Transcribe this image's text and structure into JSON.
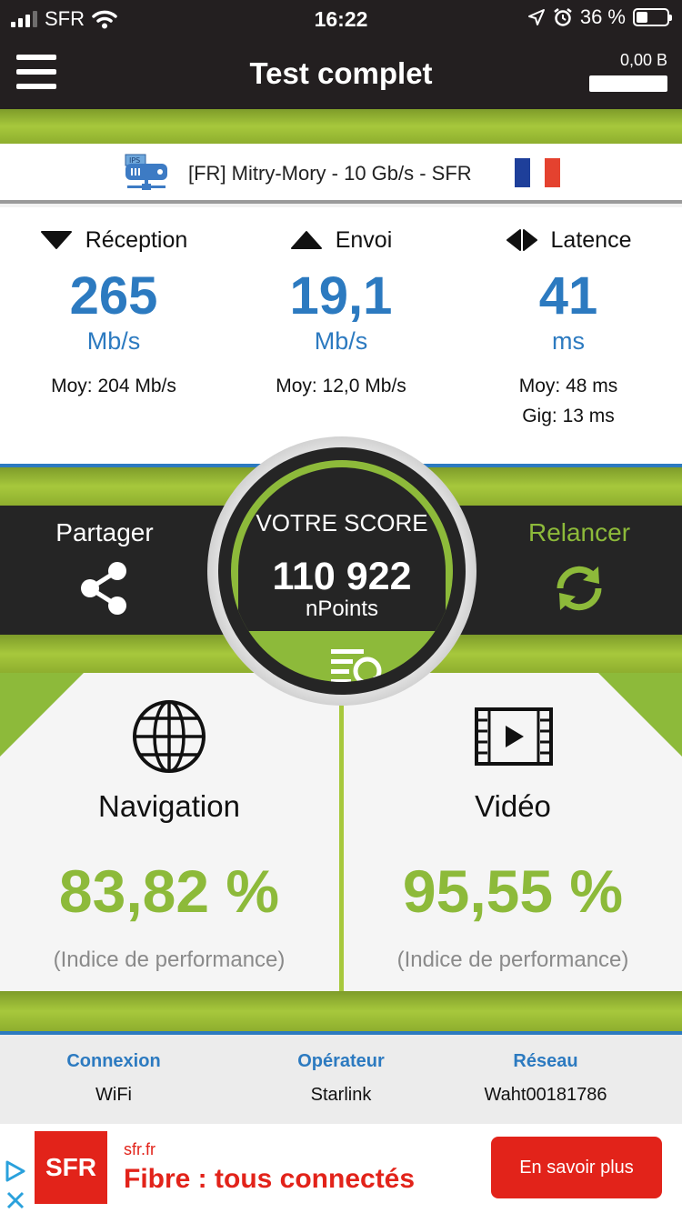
{
  "status_bar": {
    "carrier": "SFR",
    "time": "16:22",
    "battery_percent": "36 %",
    "battery_level": 0.36
  },
  "header": {
    "title": "Test complet",
    "data_used": "0,00 B"
  },
  "server": {
    "icon_label": "IPS",
    "name": "[FR] Mitry-Mory - 10 Gb/s - SFR",
    "flag_colors": [
      "#1e3f9a",
      "#ffffff",
      "#e4422f"
    ]
  },
  "metrics": {
    "download": {
      "label": "Réception",
      "value": "265",
      "unit": "Mb/s",
      "average": "Moy: 204 Mb/s"
    },
    "upload": {
      "label": "Envoi",
      "value": "19,1",
      "unit": "Mb/s",
      "average": "Moy: 12,0 Mb/s"
    },
    "latency": {
      "label": "Latence",
      "value": "41",
      "unit": "ms",
      "average": "Moy: 48 ms",
      "jitter": "Gig: 13 ms"
    }
  },
  "score": {
    "title": "VOTRE SCORE",
    "value": "110 922",
    "unit": "nPoints",
    "share_label": "Partager",
    "retry_label": "Relancer"
  },
  "panels": {
    "navigation": {
      "title": "Navigation",
      "value": "83,82 %",
      "note": "(Indice de performance)"
    },
    "video": {
      "title": "Vidéo",
      "value": "95,55 %",
      "note": "(Indice de performance)"
    }
  },
  "info": {
    "connection": {
      "label": "Connexion",
      "value": "WiFi"
    },
    "operator": {
      "label": "Opérateur",
      "value": "Starlink"
    },
    "network": {
      "label": "Réseau",
      "value": "Waht00181786"
    }
  },
  "ad": {
    "logo": "SFR",
    "domain": "sfr.fr",
    "headline": "Fibre : tous connectés",
    "cta": "En savoir plus"
  },
  "colors": {
    "accent_blue": "#2c7ac0",
    "accent_green": "#8dba3a",
    "dark": "#252525",
    "ad_red": "#e2231a"
  }
}
